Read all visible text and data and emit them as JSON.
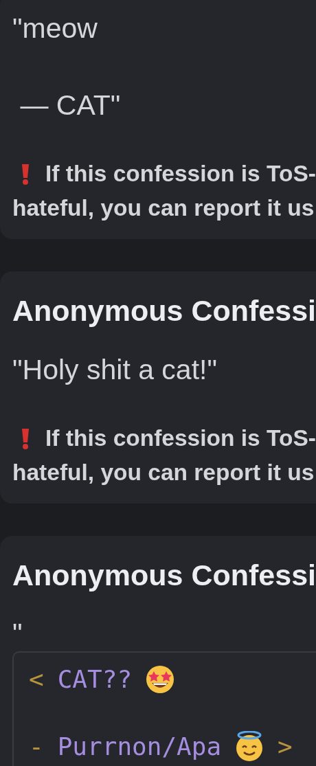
{
  "confessions": [
    {
      "quote": "\"meow\n\n — CAT\"",
      "warning_lines": [
        "If this confession is ToS-",
        "hateful, you can report it us"
      ]
    },
    {
      "title": "Anonymous Confessi",
      "quote": "\"Holy shit a cat!\"",
      "warning_lines": [
        "If this confession is ToS-",
        "hateful, you can report it us"
      ]
    },
    {
      "title": "Anonymous Confessi",
      "quote": "\"",
      "code_lines": [
        {
          "marker": "<",
          "text": "CAT??"
        },
        {
          "marker": "-",
          "text": "Purrnon/Apa",
          "end": ">"
        }
      ]
    }
  ]
}
